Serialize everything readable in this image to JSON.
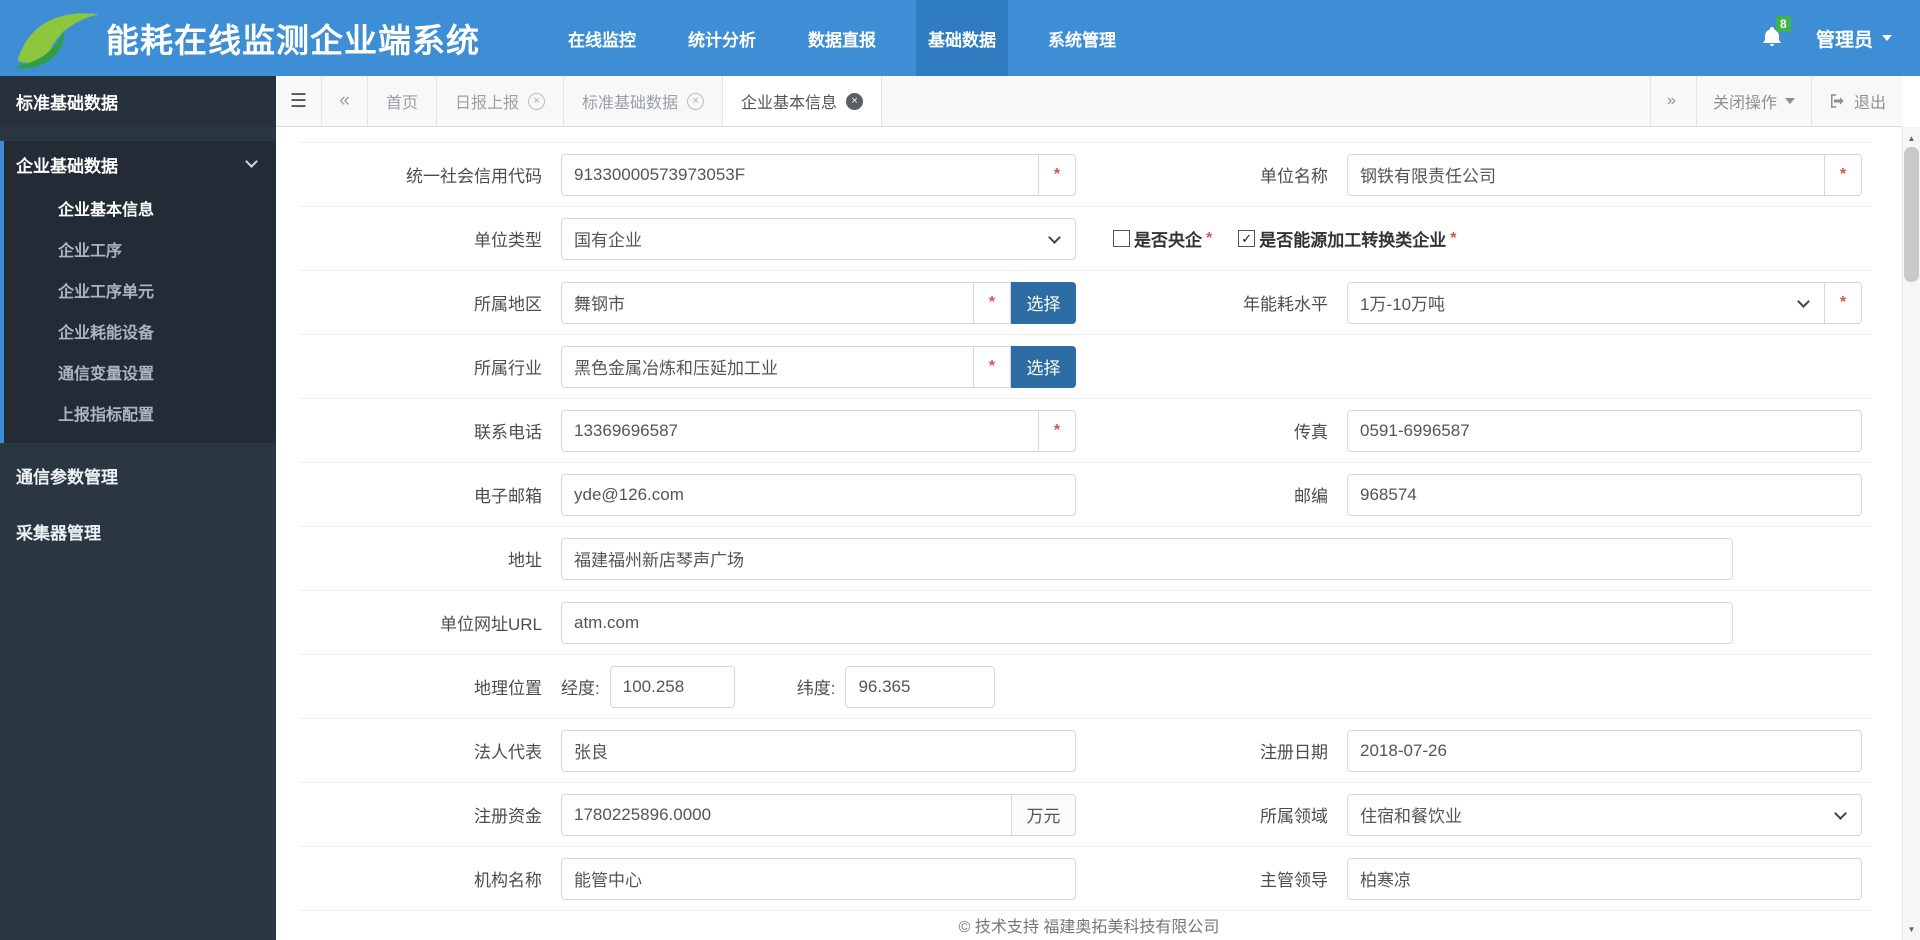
{
  "required_mark": "*",
  "icons": {
    "hamburger": "☰",
    "chevrons_left": "«",
    "chevrons_right": "»",
    "close": "×",
    "scroll_up": "▲",
    "scroll_down": "▼",
    "check": "✓"
  },
  "header": {
    "title": "能耗在线监测企业端系统",
    "nav": [
      {
        "label": "在线监控"
      },
      {
        "label": "统计分析"
      },
      {
        "label": "数据直报"
      },
      {
        "label": "基础数据"
      },
      {
        "label": "系统管理"
      }
    ],
    "notification_count": "8",
    "user_label": "管理员"
  },
  "sidebar": {
    "section_title": "标准基础数据",
    "group_label": "企业基础数据",
    "group_children": [
      "企业基本信息",
      "企业工序",
      "企业工序单元",
      "企业耗能设备",
      "通信变量设置",
      "上报指标配置"
    ],
    "items": [
      "通信参数管理",
      "采集器管理"
    ]
  },
  "tabbar": {
    "tabs": [
      "首页",
      "日报上报",
      "标准基础数据",
      "企业基本信息"
    ],
    "close_menu_label": "关闭操作",
    "exit_label": "退出"
  },
  "form": {
    "credit_code": {
      "label": "统一社会信用代码",
      "value": "91330000573973053F"
    },
    "unit_name": {
      "label": "单位名称",
      "value": "钢铁有限责任公司"
    },
    "unit_type": {
      "label": "单位类型",
      "value": "国有企业"
    },
    "is_central": {
      "label": "是否央企"
    },
    "is_energy_conv": {
      "label": "是否能源加工转换类企业"
    },
    "region": {
      "label": "所属地区",
      "value": "舞钢市",
      "button": "选择"
    },
    "energy_level": {
      "label": "年能耗水平",
      "value": "1万-10万吨"
    },
    "industry": {
      "label": "所属行业",
      "value": "黑色金属冶炼和压延加工业",
      "button": "选择"
    },
    "phone": {
      "label": "联系电话",
      "value": "13369696587"
    },
    "fax": {
      "label": "传真",
      "value": "0591-6996587"
    },
    "email": {
      "label": "电子邮箱",
      "value": "yde@126.com"
    },
    "zip": {
      "label": "邮编",
      "value": "968574"
    },
    "address": {
      "label": "地址",
      "value": "福建福州新店琴声广场"
    },
    "url": {
      "label": "单位网址URL",
      "value": "atm.com"
    },
    "geo": {
      "label": "地理位置",
      "lng_label": "经度:",
      "lng": "100.258",
      "lat_label": "纬度:",
      "lat": "96.365"
    },
    "legal": {
      "label": "法人代表",
      "value": "张良"
    },
    "reg_date": {
      "label": "注册日期",
      "value": "2018-07-26"
    },
    "capital": {
      "label": "注册资金",
      "value": "1780225896.0000",
      "unit": "万元"
    },
    "domain_field": {
      "label": "所属领域",
      "value": "住宿和餐饮业"
    },
    "org_name": {
      "label": "机构名称",
      "value": "能管中心"
    },
    "leader": {
      "label": "主管领导",
      "value": "柏寒凉"
    }
  },
  "footer_text": "© 技术支持 福建奥拓美科技有限公司"
}
